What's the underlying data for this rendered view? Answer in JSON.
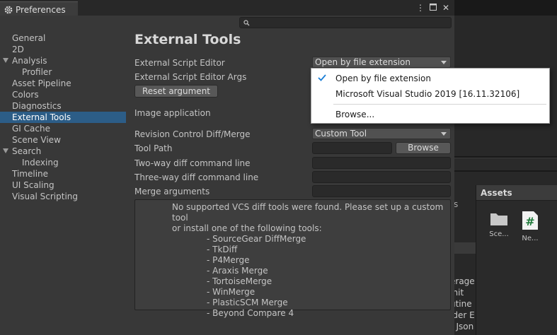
{
  "window": {
    "tab_title": "Preferences",
    "search_placeholder": ""
  },
  "sidebar": {
    "items": [
      {
        "label": "General",
        "level": 0
      },
      {
        "label": "2D",
        "level": 0
      },
      {
        "label": "Analysis",
        "level": 0,
        "expanded": true
      },
      {
        "label": "Profiler",
        "level": 1
      },
      {
        "label": "Asset Pipeline",
        "level": 0
      },
      {
        "label": "Colors",
        "level": 0
      },
      {
        "label": "Diagnostics",
        "level": 0
      },
      {
        "label": "External Tools",
        "level": 0,
        "selected": true
      },
      {
        "label": "GI Cache",
        "level": 0
      },
      {
        "label": "Scene View",
        "level": 0
      },
      {
        "label": "Search",
        "level": 0,
        "expanded": true
      },
      {
        "label": "Indexing",
        "level": 1
      },
      {
        "label": "Timeline",
        "level": 0
      },
      {
        "label": "UI Scaling",
        "level": 0
      },
      {
        "label": "Visual Scripting",
        "level": 0
      }
    ]
  },
  "main": {
    "title": "External Tools",
    "script_editor_label": "External Script Editor",
    "script_editor_value": "Open by file extension",
    "script_editor_args_label": "External Script Editor Args",
    "reset_argument_label": "Reset argument",
    "image_application_label": "Image application",
    "revision_control_label": "Revision Control Diff/Merge",
    "revision_control_value": "Custom Tool",
    "tool_path_label": "Tool Path",
    "browse_label": "Browse",
    "two_way_label": "Two-way diff command line",
    "three_way_label": "Three-way diff command line",
    "merge_args_label": "Merge arguments",
    "help_line1": "No supported VCS diff tools were found. Please set up a custom tool",
    "help_line2": "or install one of the following tools:",
    "help_tools": [
      "- SourceGear DiffMerge",
      "- TkDiff",
      "- P4Merge",
      "- Araxis Merge",
      "- TortoiseMerge",
      "- WinMerge",
      "- PlasticSCM Merge",
      "- Beyond Compare 4"
    ]
  },
  "popup": {
    "options": [
      {
        "label": "Open by file extension",
        "checked": true
      },
      {
        "label": "Microsoft Visual Studio 2019 [16.11.32106]",
        "checked": false
      }
    ],
    "browse_label": "Browse..."
  },
  "background": {
    "assets_header": "Assets",
    "asset_items": [
      {
        "label": "Sce...",
        "icon": "folder-icon"
      },
      {
        "label": "Ne...",
        "icon": "csharp-script-icon"
      }
    ],
    "truncated_side_text": [
      "s",
      "erage",
      "Jnit",
      "utine",
      "ider E",
      "t Json"
    ],
    "colors": {
      "selection": "#2c5d87",
      "window_bg": "#383838",
      "popup_bg": "#ffffff",
      "check": "#1c7fd6",
      "csharp_icon": "#1f7a3a"
    }
  }
}
